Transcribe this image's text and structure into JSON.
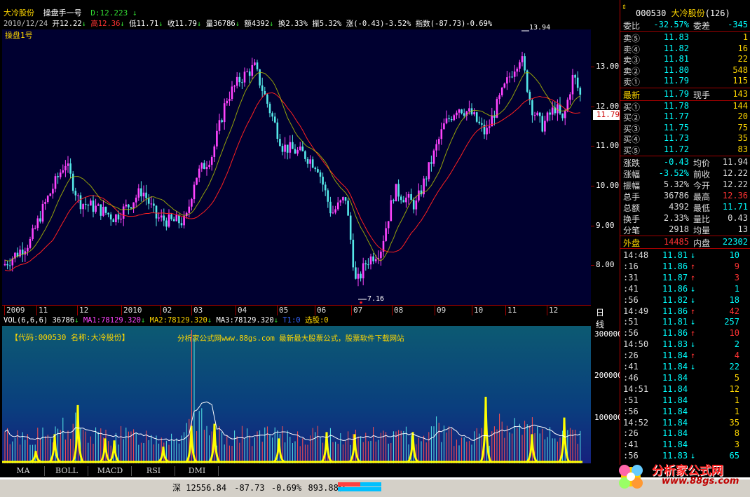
{
  "header": {
    "stock_name": "大冷股份",
    "formula_name": "操盘手一号",
    "d_label": "D:12.223",
    "date": "2010/12/24",
    "open": "开12.22",
    "high": "高12.36",
    "low": "低11.71",
    "close": "收11.79",
    "volume": "量36786",
    "amount": "额4392",
    "turnover": "换2.33%",
    "amplitude": "振5.32%",
    "change": "涨(-0.43)-3.52%",
    "index": "指数(-87.73)-0.69%",
    "panel_label": "操盘1号"
  },
  "price_chart": {
    "max_label": "13.94",
    "min_label": "7.16",
    "current_price_tag": "11.79",
    "y_ticks": [
      "13.00",
      "12.00",
      "11.00",
      "10.00",
      "9.00",
      "8.00"
    ],
    "x_labels": [
      "2009",
      "11",
      "12",
      "2010",
      "02",
      "03",
      "04",
      "05",
      "06",
      "07",
      "08",
      "09",
      "10",
      "11",
      "12"
    ],
    "period_label": "日线"
  },
  "volume_chart": {
    "indicator_line": {
      "name": "VOL(6,6,6)",
      "value": "36786",
      "ma1": "MA1:78129.320",
      "ma2": "MA2:78129.320",
      "ma3": "MA3:78129.320",
      "t1": "T1:0",
      "select": "选股:0"
    },
    "info_code": "【代码:000530 名称:大冷股份】",
    "watermark": "分析家公式网www.88gs.com 最新最大股票公式，股票软件下载网站",
    "y_ticks": [
      "300000",
      "200000",
      "100000"
    ]
  },
  "quote_panel": {
    "code": "000530",
    "name": "大冷股份",
    "count": "(126)",
    "webi": {
      "label": "委比",
      "value": "-32.57%",
      "label2": "委差",
      "value2": "-345"
    },
    "sell": [
      {
        "label": "卖⑤",
        "price": "11.83",
        "vol": "1"
      },
      {
        "label": "卖④",
        "price": "11.82",
        "vol": "16"
      },
      {
        "label": "卖③",
        "price": "11.81",
        "vol": "22"
      },
      {
        "label": "卖②",
        "price": "11.80",
        "vol": "548"
      },
      {
        "label": "卖①",
        "price": "11.79",
        "vol": "115"
      }
    ],
    "latest": {
      "label": "最新",
      "price": "11.79",
      "label2": "现手",
      "vol": "143"
    },
    "buy": [
      {
        "label": "买①",
        "price": "11.78",
        "vol": "144"
      },
      {
        "label": "买②",
        "price": "11.77",
        "vol": "20"
      },
      {
        "label": "买③",
        "price": "11.75",
        "vol": "75"
      },
      {
        "label": "买④",
        "price": "11.73",
        "vol": "35"
      },
      {
        "label": "买⑤",
        "price": "11.72",
        "vol": "83"
      }
    ],
    "stats": [
      {
        "l1": "涨跌",
        "v1": "-0.43",
        "l2": "均价",
        "v2": "11.94"
      },
      {
        "l1": "涨幅",
        "v1": "-3.52%",
        "l2": "前收",
        "v2": "12.22"
      },
      {
        "l1": "振幅",
        "v1": "5.32%",
        "l2": "今开",
        "v2": "12.22"
      },
      {
        "l1": "总手",
        "v1": "36786",
        "l2": "最高",
        "v2": "12.36"
      },
      {
        "l1": "总额",
        "v1": "4392",
        "l2": "最低",
        "v2": "11.71"
      },
      {
        "l1": "换手",
        "v1": "2.33%",
        "l2": "量比",
        "v2": "0.43"
      },
      {
        "l1": "分笔",
        "v1": "2918",
        "l2": "均量",
        "v2": "13"
      }
    ],
    "outer": {
      "l1": "外盘",
      "v1": "14485",
      "l2": "内盘",
      "v2": "22302"
    },
    "ticks": [
      {
        "t": "14:48",
        "p": "11.81",
        "d": "↓",
        "v": "10"
      },
      {
        "t": ":16",
        "p": "11.86",
        "d": "↑",
        "v": "9"
      },
      {
        "t": ":31",
        "p": "11.87",
        "d": "↑",
        "v": "3"
      },
      {
        "t": ":41",
        "p": "11.86",
        "d": "↓",
        "v": "1"
      },
      {
        "t": ":56",
        "p": "11.82",
        "d": "↓",
        "v": "18"
      },
      {
        "t": "14:49",
        "p": "11.86",
        "d": "↑",
        "v": "42"
      },
      {
        "t": ":51",
        "p": "11.81",
        "d": "↓",
        "v": "257"
      },
      {
        "t": ":56",
        "p": "11.86",
        "d": "↑",
        "v": "10"
      },
      {
        "t": "14:50",
        "p": "11.83",
        "d": "↓",
        "v": "2"
      },
      {
        "t": ":26",
        "p": "11.84",
        "d": "↑",
        "v": "4"
      },
      {
        "t": ":41",
        "p": "11.84",
        "d": "↓",
        "v": "22"
      },
      {
        "t": ":46",
        "p": "11.84",
        "d": "",
        "v": "5"
      },
      {
        "t": "14:51",
        "p": "11.84",
        "d": "",
        "v": "12"
      },
      {
        "t": ":51",
        "p": "11.84",
        "d": "",
        "v": "1"
      },
      {
        "t": ":56",
        "p": "11.84",
        "d": "",
        "v": "1"
      },
      {
        "t": "14:52",
        "p": "11.84",
        "d": "",
        "v": "35"
      },
      {
        "t": ":26",
        "p": "11.84",
        "d": "",
        "v": "8"
      },
      {
        "t": ":41",
        "p": "11.84",
        "d": "",
        "v": "3"
      },
      {
        "t": ":56",
        "p": "11.83",
        "d": "↓",
        "v": "65"
      }
    ]
  },
  "tabs": [
    "MA",
    "BOLL",
    "MACD",
    "RSI",
    "DMI"
  ],
  "status": {
    "market": "深",
    "index": "12556.84",
    "change": "-87.73",
    "pct": "-0.69%",
    "amount": "893.88亿"
  },
  "logo": {
    "text": "分析家公式网",
    "url": "www.88gs.com"
  },
  "colors": {
    "up": "#ff3333",
    "down": "#00ffff",
    "candle_up": "#ff44ff",
    "ma_red": "#ff2020",
    "ma_yellow": "#cccc00",
    "vol_spike": "#ffff00"
  }
}
